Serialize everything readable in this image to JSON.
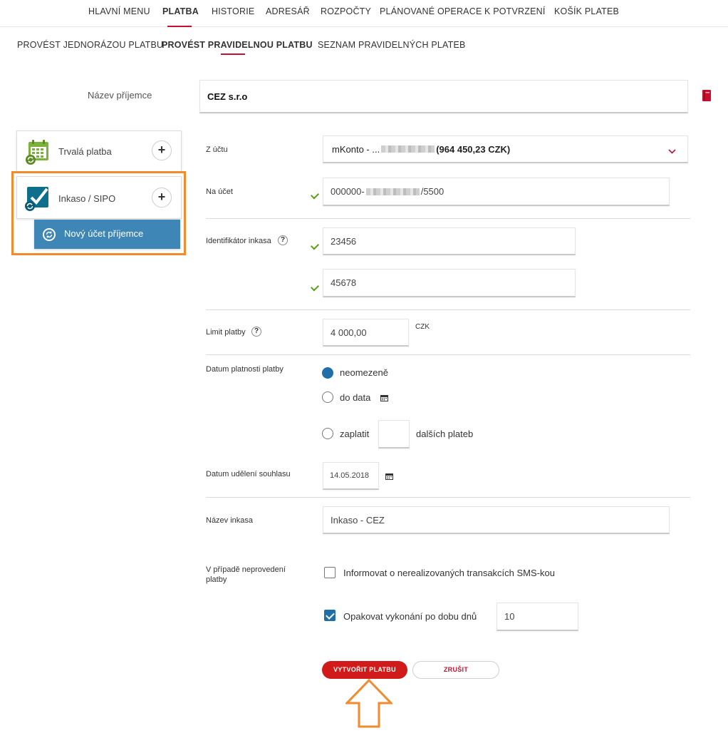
{
  "topnav": {
    "items": [
      {
        "label": "HLAVNÍ MENU"
      },
      {
        "label": "PLATBA"
      },
      {
        "label": "HISTORIE"
      },
      {
        "label": "ADRESÁŘ"
      },
      {
        "label": "ROZPOČTY"
      },
      {
        "label": "PLÁNOVANÉ OPERACE"
      },
      {
        "label": "K POTVRZENÍ"
      },
      {
        "label": "KOŠÍK PLATEB"
      }
    ]
  },
  "subnav": {
    "items": [
      {
        "label": "PROVÉST JEDNORÁZOU PLATBU"
      },
      {
        "label": "PROVÉST PRAVIDELNOU PLATBU"
      },
      {
        "label": "SEZNAM PRAVIDELNÝCH PLATEB"
      }
    ]
  },
  "recipient": {
    "label": "Název příjemce",
    "value": "CEZ s.r.o"
  },
  "sidebar": {
    "standing_order": "Trvalá platba",
    "direct_debit": "Inkaso / SIPO",
    "new_account": "Nový účet příjemce"
  },
  "form": {
    "from_account": {
      "label": "Z účtu",
      "prefix": "mKonto - ...",
      "balance": "(964 450,23 CZK)"
    },
    "to_account": {
      "label": "Na účet",
      "prefix": "000000-",
      "suffix": "/5500"
    },
    "identifier": {
      "label": "Identifikátor inkasa",
      "value1": "23456",
      "value2": "45678"
    },
    "limit": {
      "label": "Limit platby",
      "value": "4 000,00",
      "currency": "CZK"
    },
    "validity": {
      "label": "Datum platnosti platby",
      "opt_unlimited": "neomezeně",
      "opt_until": "do data",
      "opt_pay": "zaplatit",
      "opt_pay_suffix": "dalších plateb"
    },
    "consent_date": {
      "label": "Datum udělení souhlasu",
      "value": "14.05.2018"
    },
    "debit_name": {
      "label": "Název inkasa",
      "value": "Inkaso - CEZ"
    },
    "failure": {
      "label_line1": "V případě neprovedení",
      "label_line2": "platby",
      "sms_notify": "Informovat o nerealizovaných transakcích SMS-kou",
      "repeat": "Opakovat vykonání po dobu dnů",
      "repeat_days": "10"
    }
  },
  "buttons": {
    "create": "VYTVOŘIT PLATBU",
    "cancel": "ZRUŠIT"
  },
  "colors": {
    "accent_red": "#c8102e",
    "highlight_orange": "#f28a2e",
    "button_blue": "#3d86b5",
    "check_green": "#5a9e1a"
  }
}
